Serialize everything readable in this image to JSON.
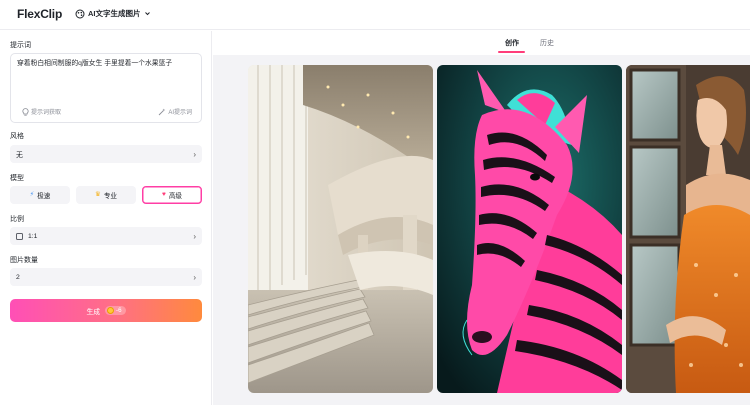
{
  "app": {
    "brand": "FlexClip",
    "tool_label": "AI文字生成图片"
  },
  "left_panel": {
    "prompt": {
      "label": "提示词",
      "value": "穿着粉白相间制服的q版女生 手里提着一个水果篮子",
      "inspiration_label": "提示词获取",
      "ai_prompt_label": "AI提示词"
    },
    "style": {
      "label": "风格",
      "value": "无"
    },
    "model": {
      "label": "模型",
      "options": [
        {
          "label": "极速",
          "icon": "lightning-icon",
          "color": "#3a8df0"
        },
        {
          "label": "专业",
          "icon": "crown-icon",
          "color": "#f5b21c"
        },
        {
          "label": "高级",
          "icon": "heart-icon",
          "color": "#ff3d7a"
        }
      ],
      "selected": "高级"
    },
    "ratio": {
      "label": "比例",
      "value": "1:1"
    },
    "count": {
      "label": "图片数量",
      "value": "2"
    },
    "generate": {
      "label": "生成",
      "cost": "-6"
    }
  },
  "right_panel": {
    "tabs": [
      {
        "label": "创作",
        "active": true
      },
      {
        "label": "历史",
        "active": false
      }
    ],
    "gallery": [
      {
        "name": "architecture-stairs-image"
      },
      {
        "name": "pink-zebra-image"
      },
      {
        "name": "woman-window-image"
      }
    ]
  },
  "colors": {
    "accent_pink": "#ff3d7a",
    "gradient_start": "#ff4fb6",
    "gradient_end": "#ff8a3d",
    "brand_orange": "#ff6a2b"
  }
}
